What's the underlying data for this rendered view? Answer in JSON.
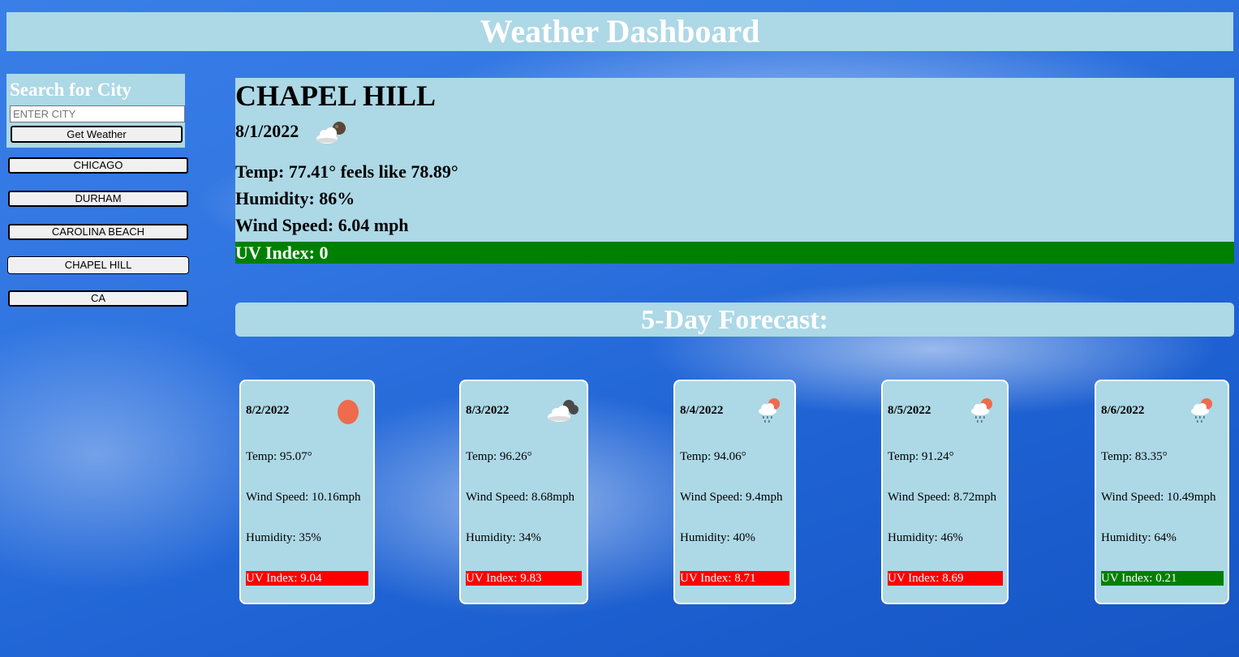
{
  "header": {
    "title": "Weather Dashboard"
  },
  "search": {
    "title": "Search for City",
    "placeholder": "ENTER CITY",
    "button_label": "Get Weather"
  },
  "history": [
    "CHICAGO",
    "DURHAM",
    "CAROLINA BEACH",
    "CHAPEL HILL",
    "CA"
  ],
  "current": {
    "city": "CHAPEL HILL",
    "date": "8/1/2022",
    "icon": "cloud-night-icon",
    "temp": "Temp: 77.41° feels like 78.89°",
    "humidity": "Humidity: 86%",
    "wind": "Wind Speed: 6.04 mph",
    "uv": "UV Index: 0",
    "uv_color": "#008000"
  },
  "forecast": {
    "title": "5-Day Forecast:",
    "days": [
      {
        "date": "8/2/2022",
        "icon": "sun-icon",
        "temp": "Temp: 95.07°",
        "wind": "Wind Speed: 10.16mph",
        "humidity": "Humidity: 35%",
        "uv": "UV Index: 9.04",
        "uv_color": "#ff0000"
      },
      {
        "date": "8/3/2022",
        "icon": "cloudy-icon",
        "temp": "Temp: 96.26°",
        "wind": "Wind Speed: 8.68mph",
        "humidity": "Humidity: 34%",
        "uv": "UV Index: 9.83",
        "uv_color": "#ff0000"
      },
      {
        "date": "8/4/2022",
        "icon": "rain-sun-icon",
        "temp": "Temp: 94.06°",
        "wind": "Wind Speed: 9.4mph",
        "humidity": "Humidity: 40%",
        "uv": "UV Index: 8.71",
        "uv_color": "#ff0000"
      },
      {
        "date": "8/5/2022",
        "icon": "rain-sun-icon",
        "temp": "Temp: 91.24°",
        "wind": "Wind Speed: 8.72mph",
        "humidity": "Humidity: 46%",
        "uv": "UV Index: 8.69",
        "uv_color": "#ff0000"
      },
      {
        "date": "8/6/2022",
        "icon": "rain-sun-icon",
        "temp": "Temp: 83.35°",
        "wind": "Wind Speed: 10.49mph",
        "humidity": "Humidity: 64%",
        "uv": "UV Index: 0.21",
        "uv_color": "#008000"
      }
    ]
  }
}
